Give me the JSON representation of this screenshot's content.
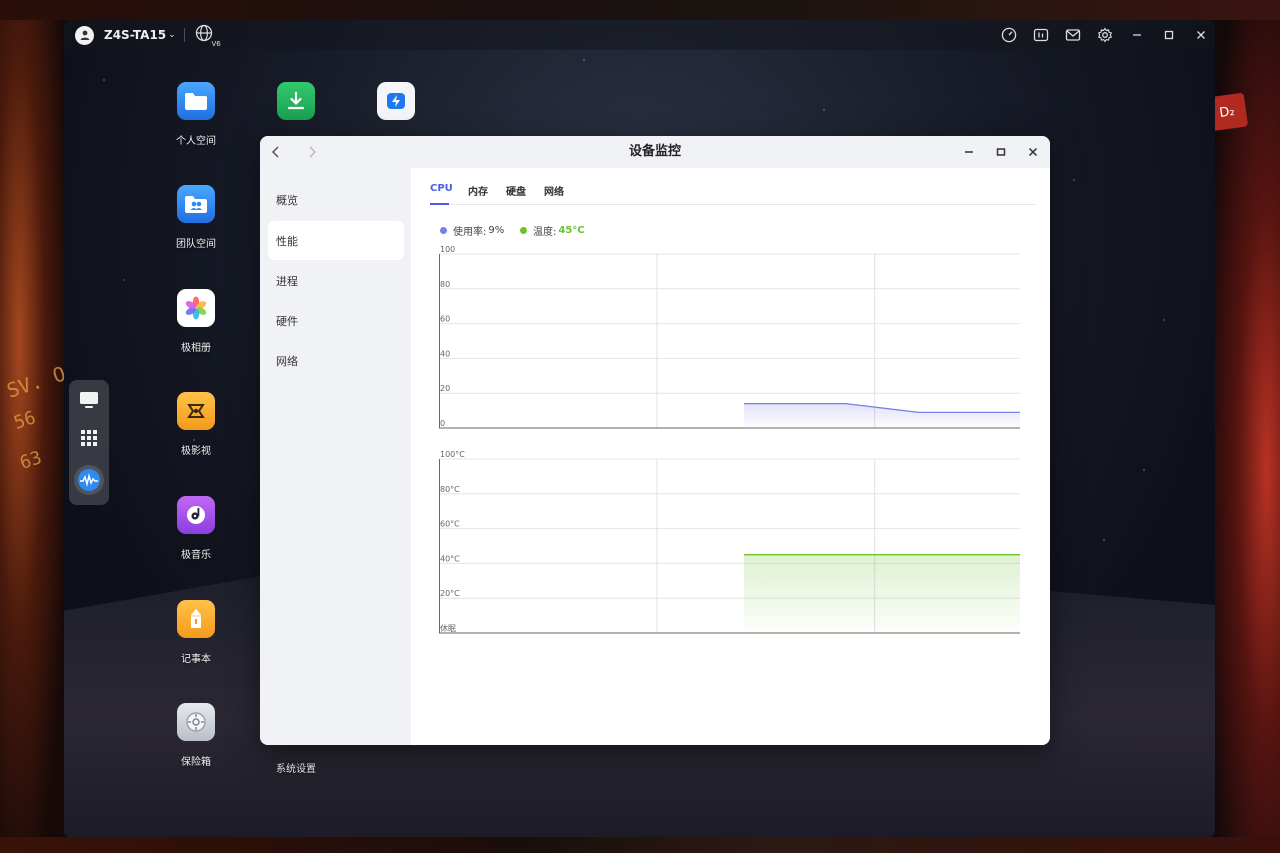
{
  "topbar": {
    "device_name": "Z4S-TA15",
    "net_badge": "V6",
    "icons": [
      "user-icon",
      "globe-icon",
      "speed-icon",
      "task-icon",
      "mail-icon",
      "gear-icon",
      "minimize-icon",
      "maximize-icon",
      "close-icon"
    ]
  },
  "desktop": {
    "apps": [
      {
        "label": "个人空间",
        "icon": "folder-icon",
        "color": "#2f8bf0"
      },
      {
        "label": "团队空间",
        "icon": "team-folder-icon",
        "color": "#2f8bf0"
      },
      {
        "label": "极相册",
        "icon": "photos-icon",
        "color": "#ffffff"
      },
      {
        "label": "极影视",
        "icon": "video-icon",
        "color": "#f6a531"
      },
      {
        "label": "极音乐",
        "icon": "music-icon",
        "color": "#a35ae6"
      },
      {
        "label": "记事本",
        "icon": "notes-icon",
        "color": "#f6a531"
      },
      {
        "label": "保险箱",
        "icon": "safe-icon",
        "color": "#cfd3da"
      }
    ],
    "footer_label": "系统设置"
  },
  "dock": {
    "items": [
      "monitor-icon",
      "apps-grid-icon",
      "device-monitor-app-icon"
    ]
  },
  "window": {
    "title": "设备监控",
    "sidebar": [
      "概览",
      "性能",
      "进程",
      "硬件",
      "网络"
    ],
    "active_sidebar": "性能",
    "tabs": [
      "CPU",
      "内存",
      "硬盘",
      "网络"
    ],
    "active_tab": "CPU",
    "usage": {
      "label": "使用率:",
      "value": "9%",
      "color": "#7b7fe8"
    },
    "temperature": {
      "label": "温度:",
      "value": "45°C",
      "color": "#6ac22e"
    }
  },
  "chart_data": [
    {
      "type": "area",
      "title": "",
      "ylim": [
        0,
        100
      ],
      "y_ticks": [
        "100",
        "80",
        "60",
        "40",
        "20",
        "0"
      ],
      "series": [
        {
          "x": [
            0,
            0.525,
            0.7,
            0.825,
            1.0
          ],
          "values": [
            null,
            14,
            14,
            9,
            9
          ]
        }
      ],
      "color": "#7b7fe8",
      "grid": true
    },
    {
      "type": "area",
      "title": "",
      "ylim": [
        0,
        100
      ],
      "y_ticks": [
        "100°C",
        "80°C",
        "60°C",
        "40°C",
        "20°C",
        "休眠"
      ],
      "series": [
        {
          "x": [
            0,
            0.525,
            1.0
          ],
          "values": [
            null,
            45,
            45
          ]
        }
      ],
      "color": "#6ac22e",
      "grid": true
    }
  ]
}
